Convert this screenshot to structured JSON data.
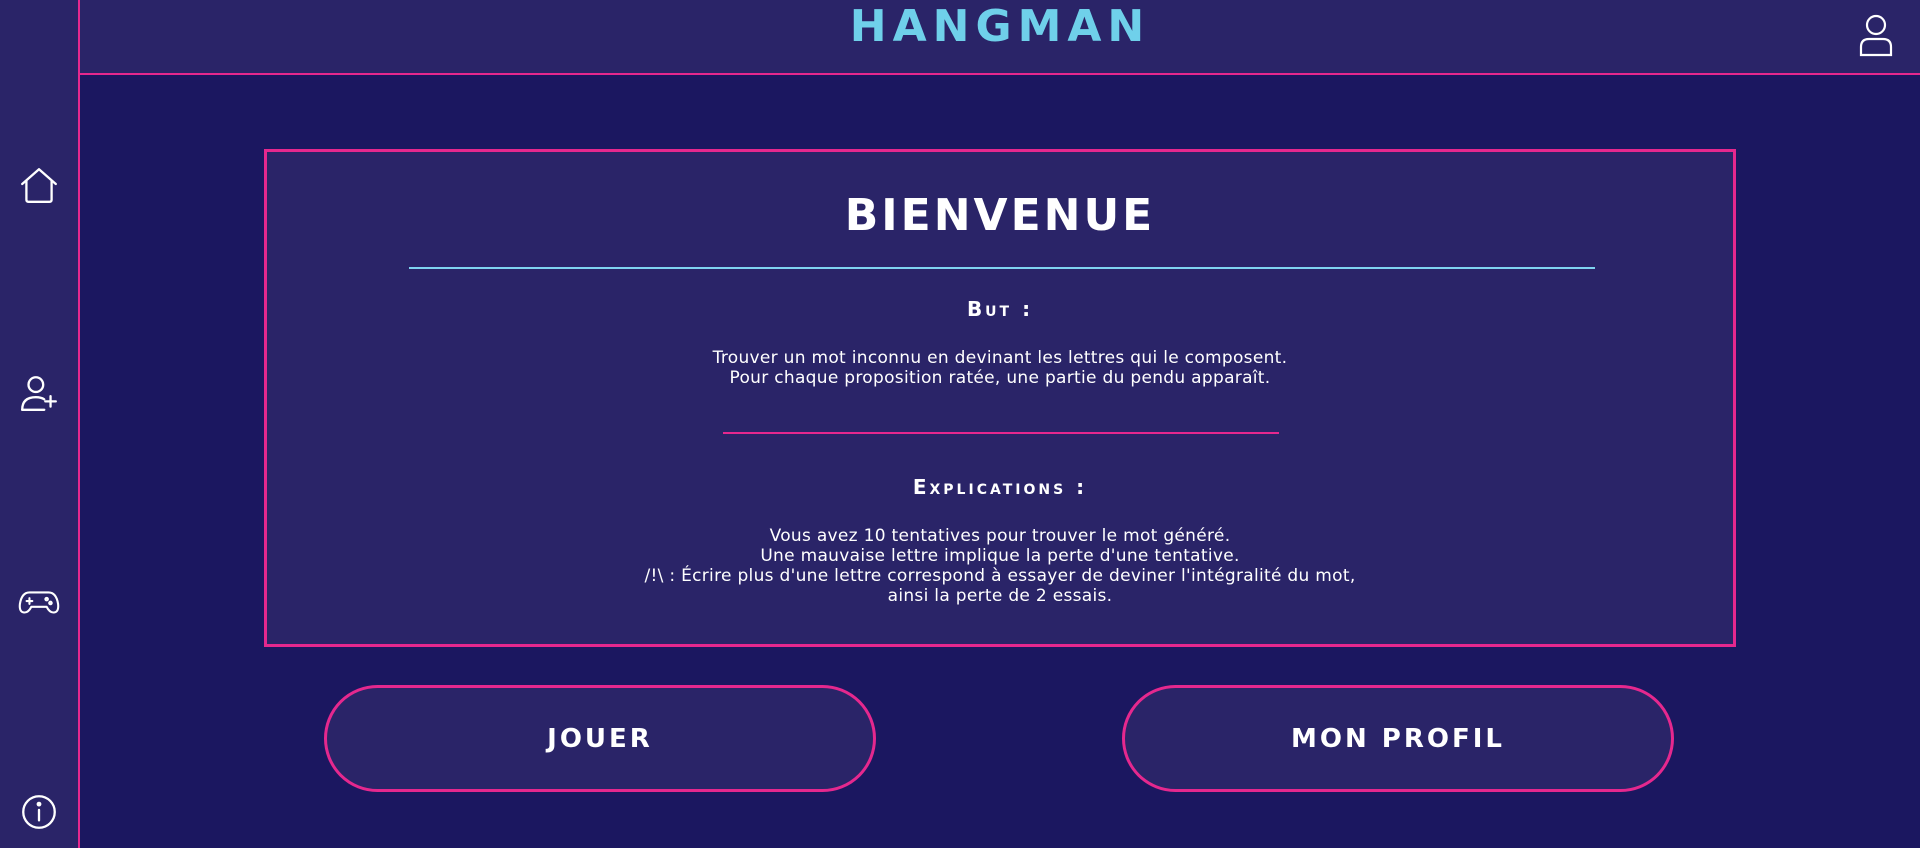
{
  "header": {
    "logo_text": "HANGMAN"
  },
  "sidebar": {
    "items": [
      {
        "icon": "home-icon"
      },
      {
        "icon": "add-user-icon"
      },
      {
        "icon": "gamepad-icon"
      },
      {
        "icon": "info-icon"
      }
    ]
  },
  "card": {
    "title": "BIENVENUE",
    "goal_heading": "But :",
    "goal_lines": [
      "Trouver un mot inconnu en devinant les lettres qui le composent.",
      "Pour chaque proposition ratée, une partie du pendu apparaît."
    ],
    "explanations_heading": "Explications :",
    "explanations_lines": [
      "Vous avez 10 tentatives pour trouver le mot généré.",
      "Une mauvaise lettre implique la perte d'une tentative.",
      "/!\\ : Écrire plus d'une lettre correspond à essayer de deviner l'intégralité du mot,",
      "ainsi la perte de 2 essais."
    ]
  },
  "actions": {
    "play_label": "JOUER",
    "profile_label": "MON PROFIL"
  },
  "colors": {
    "background": "#1b1760",
    "panel": "#2a2468",
    "accent_pink": "#e5288e",
    "accent_cyan": "#6fd0ea"
  }
}
